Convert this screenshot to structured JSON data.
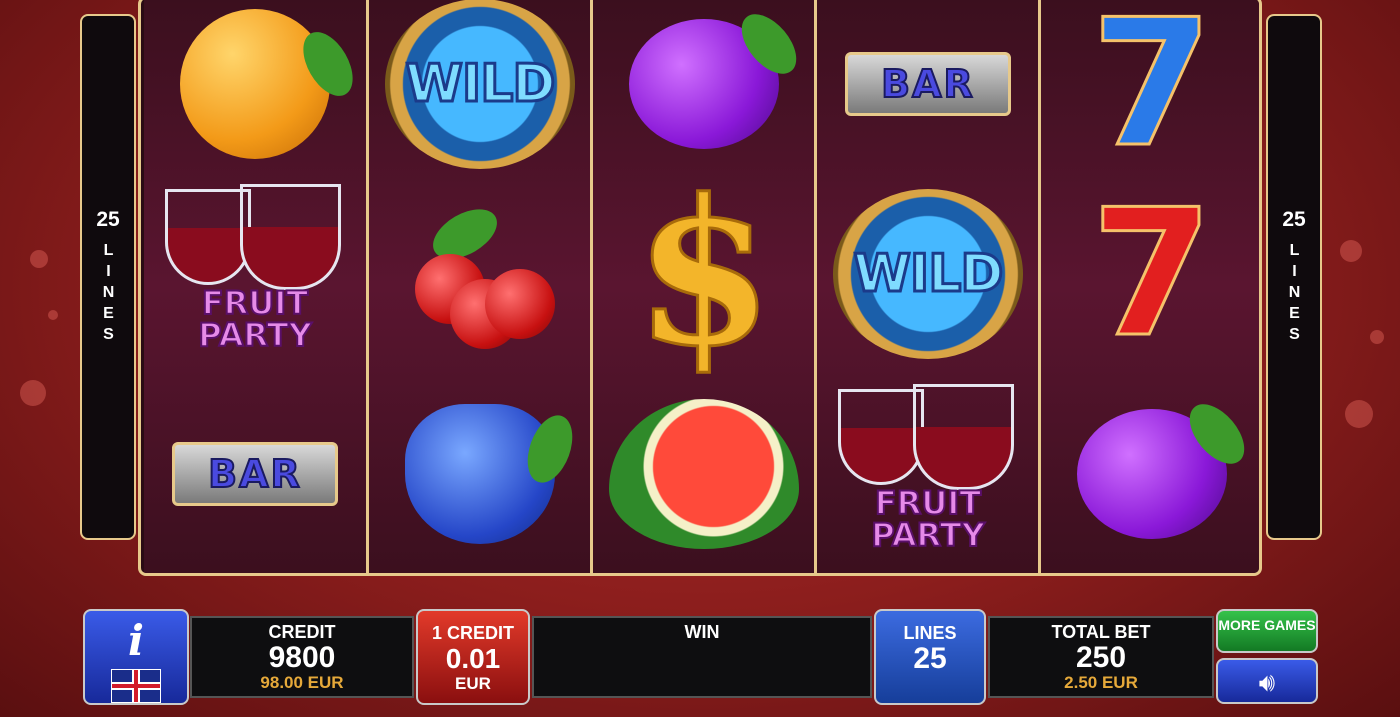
{
  "reels": [
    [
      "orange",
      "fruit-party",
      "bar"
    ],
    [
      "wild",
      "cherry",
      "grapes"
    ],
    [
      "plum",
      "dollar",
      "watermelon"
    ],
    [
      "bar",
      "wild",
      "fruit-party"
    ],
    [
      "seven-blue",
      "seven-red",
      "plum"
    ]
  ],
  "symbol_text": {
    "wild": "WILD",
    "bar": "BAR",
    "fruit_party_line1": "FRUIT",
    "fruit_party_line2": "PARTY",
    "dollar": "$",
    "seven": "7"
  },
  "side_panels": {
    "left": {
      "count": "25",
      "word": "LINES"
    },
    "right": {
      "count": "25",
      "word": "LINES"
    }
  },
  "bottom": {
    "info_glyph": "i",
    "flag": "uk-flag",
    "credit": {
      "label": "CREDIT",
      "value": "9800",
      "money": "98.00 EUR"
    },
    "denomination": {
      "label": "1 CREDIT",
      "value": "0.01",
      "currency": "EUR"
    },
    "win": {
      "label": "WIN",
      "value": ""
    },
    "lines": {
      "label": "LINES",
      "value": "25"
    },
    "total_bet": {
      "label": "TOTAL BET",
      "value": "250",
      "money": "2.50 EUR"
    },
    "more_games": "MORE GAMES",
    "sound_icon": "speaker-icon"
  },
  "colors": {
    "frame_gold": "#e7c98b",
    "background_red": "#a8282a",
    "denomination_red": "#c81e1e",
    "lines_blue": "#2a55c8",
    "more_games_green": "#2aa83a"
  }
}
